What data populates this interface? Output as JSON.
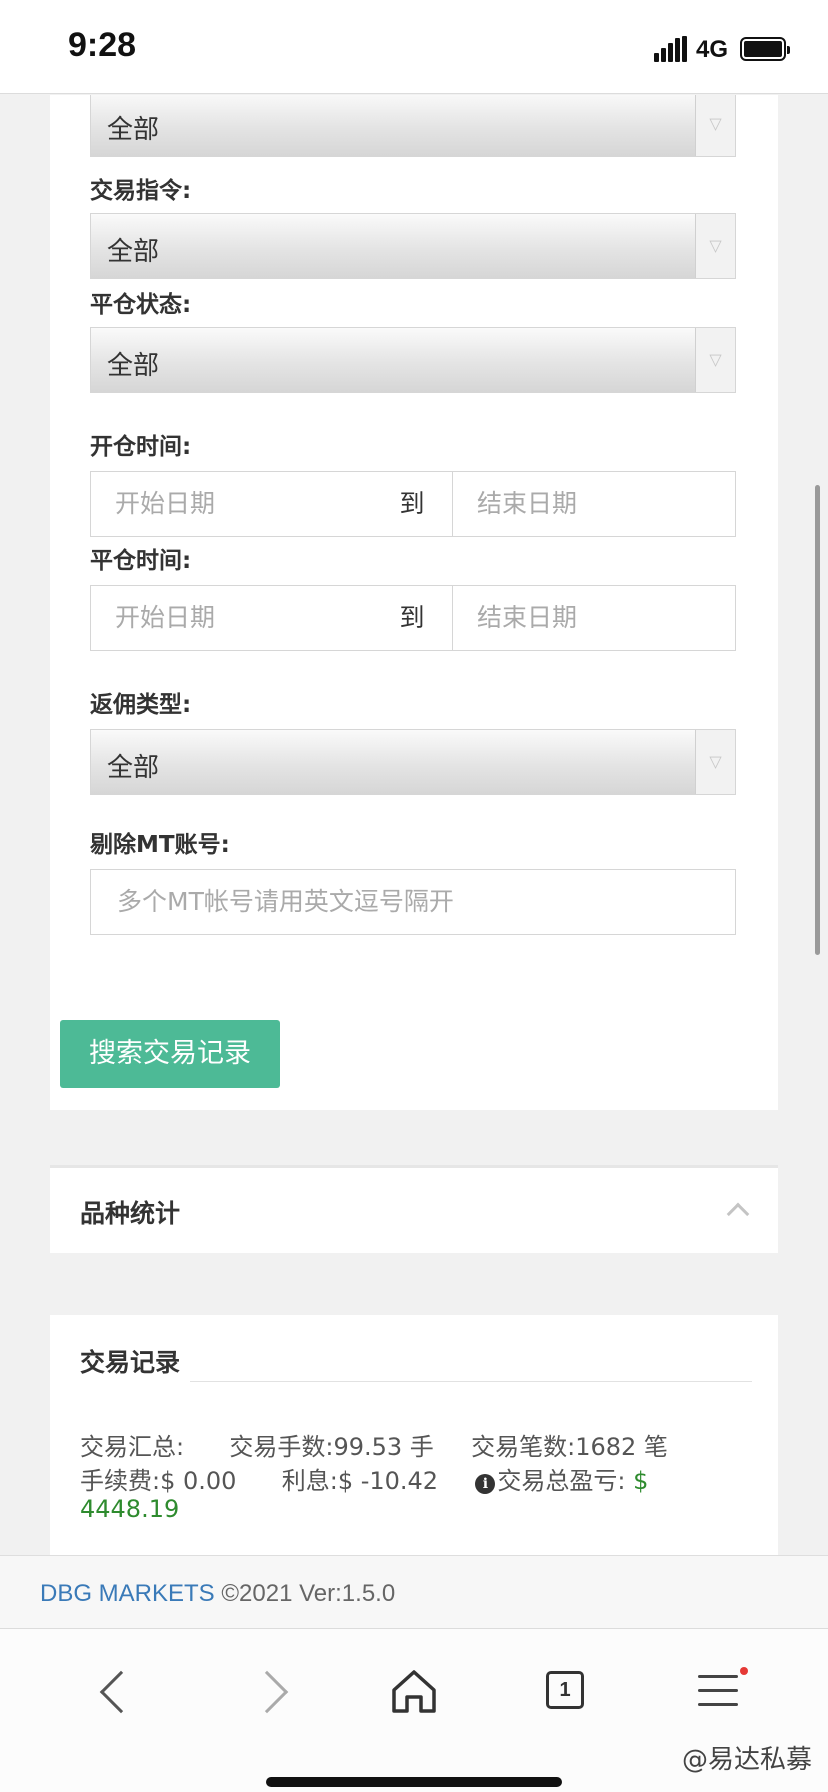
{
  "status_bar": {
    "time": "9:28",
    "network": "4G"
  },
  "form": {
    "first_select_value": "全部",
    "trade_cmd": {
      "label": "交易指令:",
      "value": "全部"
    },
    "close_status": {
      "label": "平仓状态:",
      "value": "全部"
    },
    "open_time": {
      "label": "开仓时间:",
      "start_placeholder": "开始日期",
      "separator": "到",
      "end_placeholder": "结束日期"
    },
    "close_time": {
      "label": "平仓时间:",
      "start_placeholder": "开始日期",
      "separator": "到",
      "end_placeholder": "结束日期"
    },
    "rebate_type": {
      "label": "返佣类型:",
      "value": "全部"
    },
    "exclude_mt": {
      "label": "剔除MT账号:",
      "placeholder": "多个MT帐号请用英文逗号隔开"
    },
    "search_button": "搜索交易记录"
  },
  "symbol_stats": {
    "title": "品种统计"
  },
  "trade_records": {
    "title": "交易记录",
    "summary_label": "交易汇总:",
    "lots_label": "交易手数:",
    "lots_value": "99.53 手",
    "count_label": "交易笔数:",
    "count_value": "1682 笔",
    "fee_label": "手续费:",
    "fee_value": "$ 0.00",
    "interest_label": "利息:",
    "interest_value": "$ -10.42",
    "pnl_label": "交易总盈亏:",
    "pnl_currency": "$",
    "pnl_value": "4448.19"
  },
  "footer": {
    "brand": "DBG MARKETS",
    "copyright": "©2021 Ver:1.5.0"
  },
  "toolbar": {
    "tab_count": "1"
  },
  "watermark": "@易达私募"
}
